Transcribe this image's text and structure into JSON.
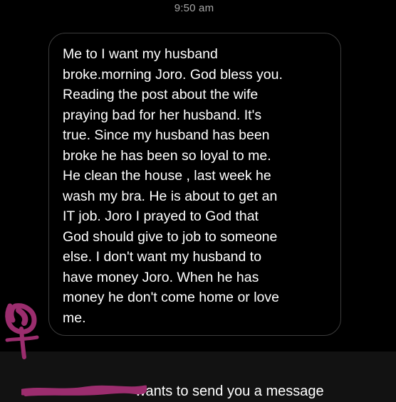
{
  "chat": {
    "timestamp": "9:50 am",
    "message": {
      "lines": [
        "Me to I want my husband",
        "broke.morning Joro. God bless you.",
        "Reading the post about the wife",
        "praying bad for her husband. It's",
        "true. Since my husband has been",
        "broke he has been so loyal to me.",
        "He clean the house , last week he",
        "wash my bra. He is about to get an",
        "IT job. Joro I prayed to God that",
        "God should give to job to someone",
        "else. I don't want my husband to",
        "have money Joro. When he has",
        "money he don't come home or love",
        "me."
      ]
    }
  },
  "request_banner": {
    "text": "wants to send you a message"
  },
  "colors": {
    "background": "#000000",
    "bubble_border": "#3c3c3c",
    "timestamp": "#a6a6a6",
    "footer_background": "#121212",
    "redaction_ink": "#9b2d6e"
  },
  "icons": {
    "redaction": "redaction-scribble",
    "avatar": "avatar-scribble"
  }
}
